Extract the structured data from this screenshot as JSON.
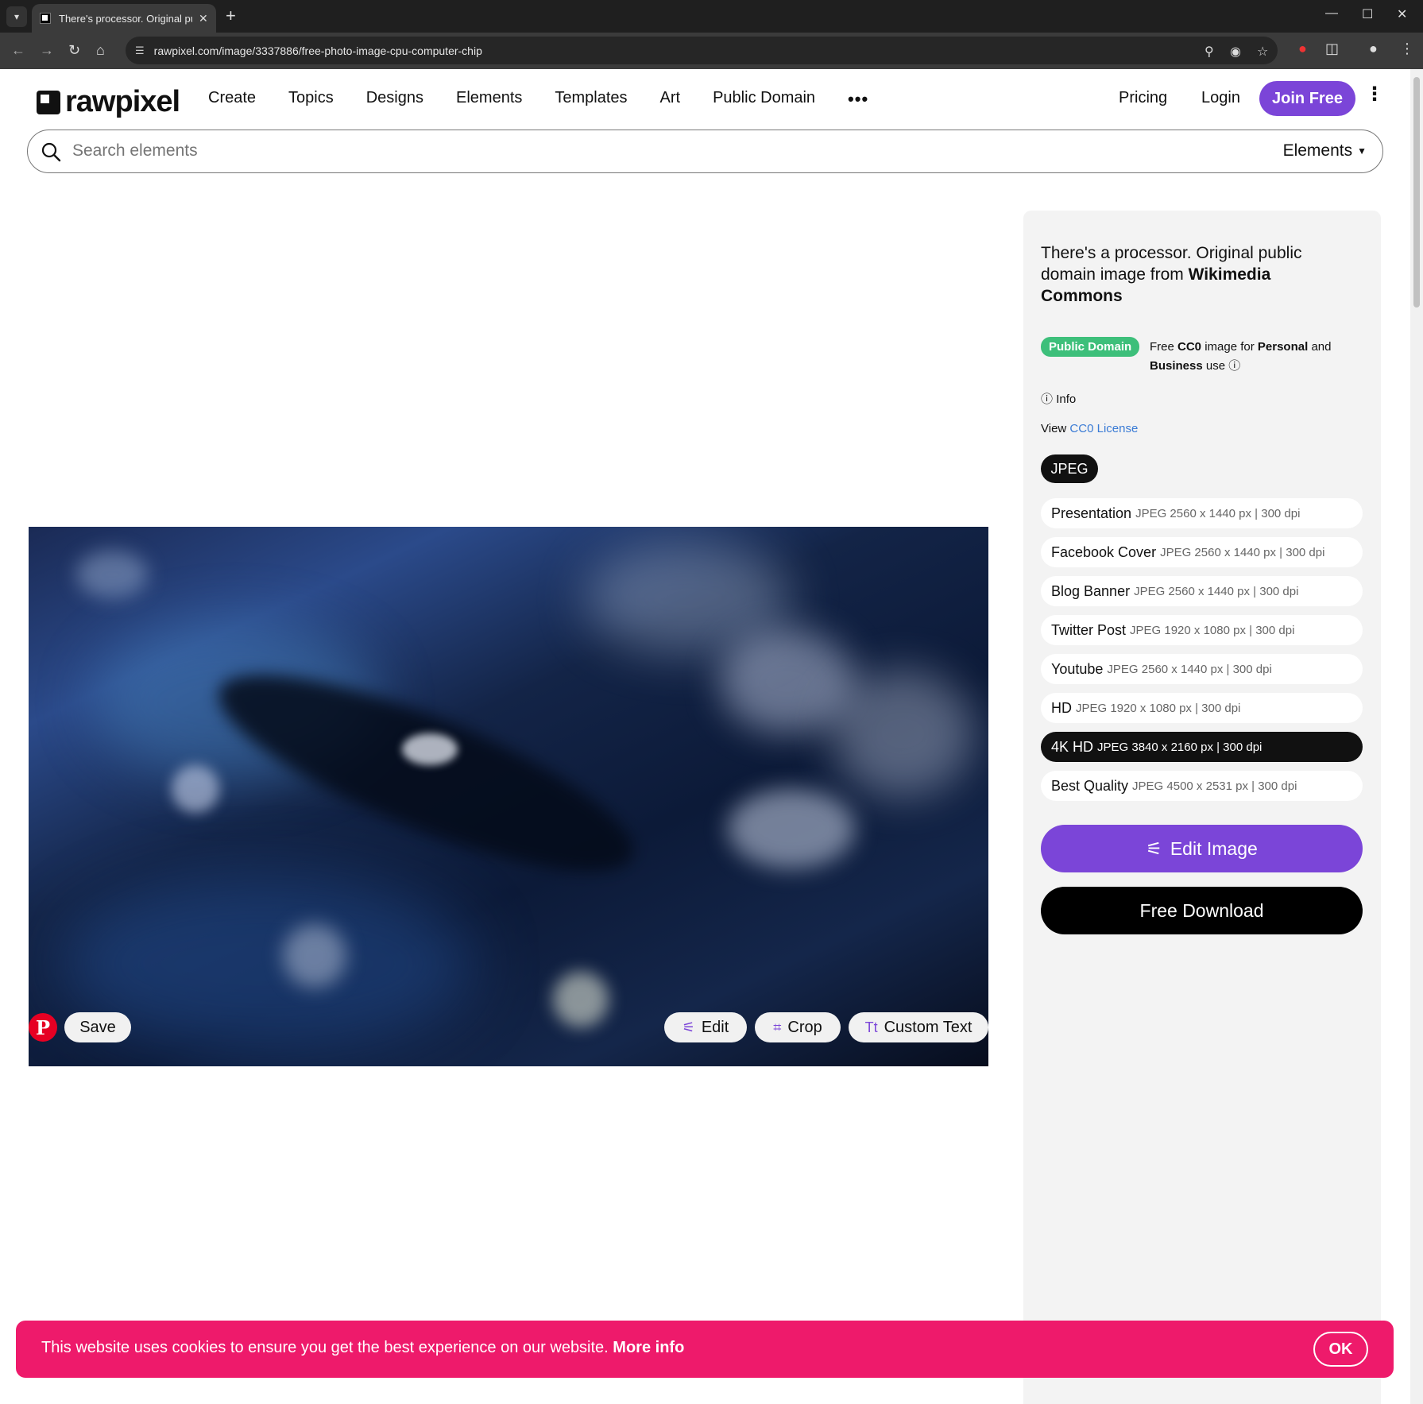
{
  "browser": {
    "tab_title": "There's processor. Original publ",
    "url": "rawpixel.com/image/3337886/free-photo-image-cpu-computer-chip"
  },
  "header": {
    "logo_text": "rawpixel",
    "nav": [
      "Create",
      "Topics",
      "Designs",
      "Elements",
      "Templates",
      "Art",
      "Public Domain"
    ],
    "more_label": "•••",
    "pricing": "Pricing",
    "login": "Login",
    "join": "Join Free"
  },
  "search": {
    "placeholder": "Search elements",
    "scope": "Elements"
  },
  "image_actions": {
    "save": "Save",
    "edit": "Edit",
    "crop": "Crop",
    "custom_text": "Custom Text"
  },
  "sidebar": {
    "title_part1": "There's a processor. Original public domain image from ",
    "title_bold": "Wikimedia Commons",
    "badge": "Public Domain",
    "license_free": "Free ",
    "license_cc0": "CC0",
    "license_mid": " image for ",
    "license_personal": "Personal",
    "license_and": " and ",
    "license_business": "Business",
    "license_use": " use",
    "info": "Info",
    "view": "View ",
    "cc0_link": "CC0 License",
    "format": "JPEG",
    "sizes": [
      {
        "name": "Presentation",
        "spec": "JPEG 2560 x 1440 px | 300 dpi",
        "selected": false
      },
      {
        "name": "Facebook Cover",
        "spec": "JPEG 2560 x 1440 px | 300 dpi",
        "selected": false
      },
      {
        "name": "Blog Banner",
        "spec": "JPEG 2560 x 1440 px | 300 dpi",
        "selected": false
      },
      {
        "name": "Twitter Post",
        "spec": "JPEG 1920 x 1080 px | 300 dpi",
        "selected": false
      },
      {
        "name": "Youtube",
        "spec": "JPEG 2560 x 1440 px | 300 dpi",
        "selected": false
      },
      {
        "name": "HD",
        "spec": "JPEG 1920 x 1080 px | 300 dpi",
        "selected": false
      },
      {
        "name": "4K HD",
        "spec": "JPEG 3840 x 2160 px | 300 dpi",
        "selected": true
      },
      {
        "name": "Best Quality",
        "spec": "JPEG 4500 x 2531 px | 300 dpi",
        "selected": false
      }
    ],
    "edit_image": "Edit Image",
    "free_download": "Free Download"
  },
  "cookie": {
    "message": "This website uses cookies to ensure you get the best experience on our website. ",
    "more_info": "More info",
    "ok": "OK"
  },
  "colors": {
    "brand_purple": "#7b45d8",
    "public_domain_green": "#3dbf7a",
    "cookie_pink": "#ee1a6b"
  }
}
